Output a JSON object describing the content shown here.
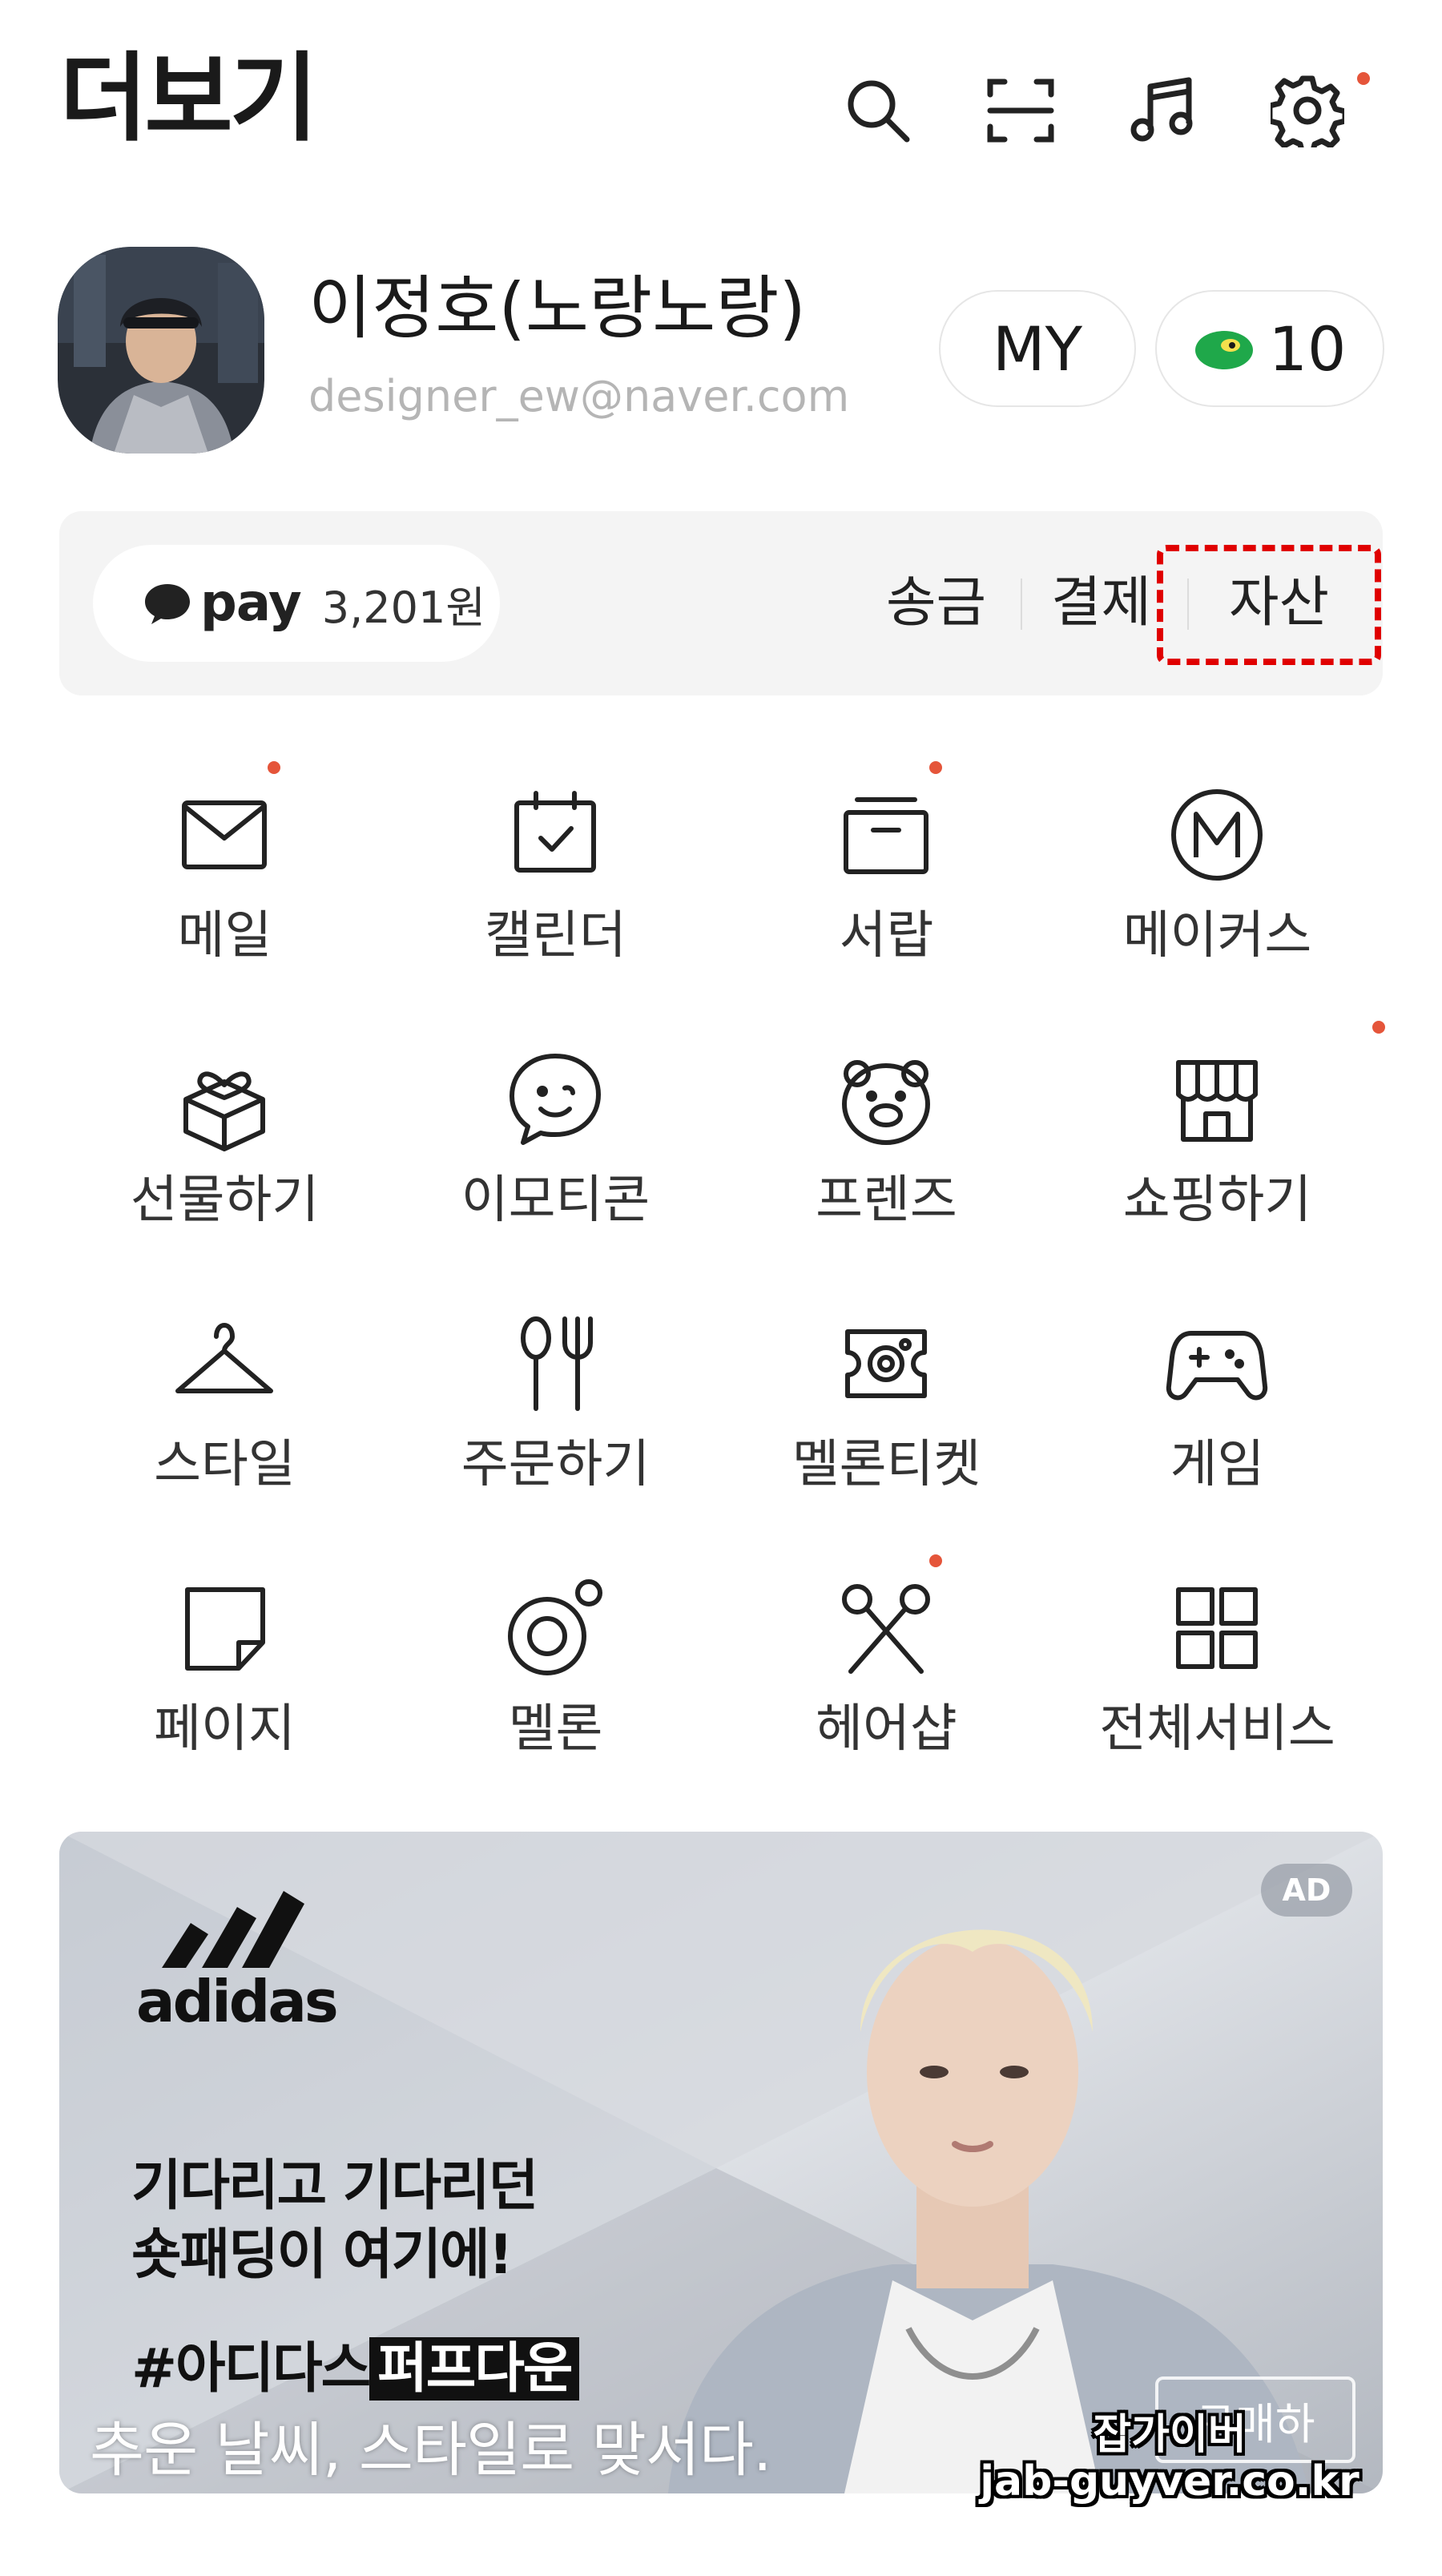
{
  "header": {
    "title": "더보기",
    "icons": [
      "search-icon",
      "scan-icon",
      "music-icon",
      "gear-icon"
    ],
    "settings_has_badge": true
  },
  "profile": {
    "name": "이정호(노랑노랑)",
    "email": "designer_ew@naver.com",
    "my_label": "MY",
    "points": "10"
  },
  "pay": {
    "logo": "pay",
    "balance": "3,201원",
    "links": [
      "송금",
      "결제",
      "자산"
    ],
    "highlighted_link": "자산"
  },
  "services": [
    {
      "label": "메일",
      "icon": "mail-icon",
      "badge": true
    },
    {
      "label": "캘린더",
      "icon": "calendar-icon",
      "badge": false
    },
    {
      "label": "서랍",
      "icon": "drawer-icon",
      "badge": true
    },
    {
      "label": "메이커스",
      "icon": "makers-icon",
      "badge": false
    },
    {
      "label": "선물하기",
      "icon": "gift-icon",
      "badge": false
    },
    {
      "label": "이모티콘",
      "icon": "emoticon-icon",
      "badge": false
    },
    {
      "label": "프렌즈",
      "icon": "friends-icon",
      "badge": false
    },
    {
      "label": "쇼핑하기",
      "icon": "shop-icon",
      "badge": true
    },
    {
      "label": "스타일",
      "icon": "hanger-icon",
      "badge": false
    },
    {
      "label": "주문하기",
      "icon": "order-icon",
      "badge": false
    },
    {
      "label": "멜론티켓",
      "icon": "ticket-icon",
      "badge": false
    },
    {
      "label": "게임",
      "icon": "gamepad-icon",
      "badge": false
    },
    {
      "label": "페이지",
      "icon": "page-icon",
      "badge": false
    },
    {
      "label": "멜론",
      "icon": "melon-icon",
      "badge": false
    },
    {
      "label": "헤어샵",
      "icon": "scissors-icon",
      "badge": true
    },
    {
      "label": "전체서비스",
      "icon": "grid-icon",
      "badge": false
    }
  ],
  "ad": {
    "badge": "AD",
    "brand": "adidas",
    "headline_1": "기다리고 기다리던",
    "headline_2": "숏패딩이 여기에!",
    "hashtag": "#아디다스",
    "hashtag_highlight": "퍼프다운",
    "subtitle": "추운 날씨, 스타일로 맞서다.",
    "cta": "구매하"
  },
  "watermark": {
    "line1": "잡가이버",
    "line2": "jab-guyver.co.kr"
  },
  "colors": {
    "badge_dot": "#e5553a",
    "highlight_border": "#e00000",
    "pay_bar_bg": "#f4f4f4",
    "email_gray": "#b5b5b5",
    "points_green": "#1fa84a"
  }
}
